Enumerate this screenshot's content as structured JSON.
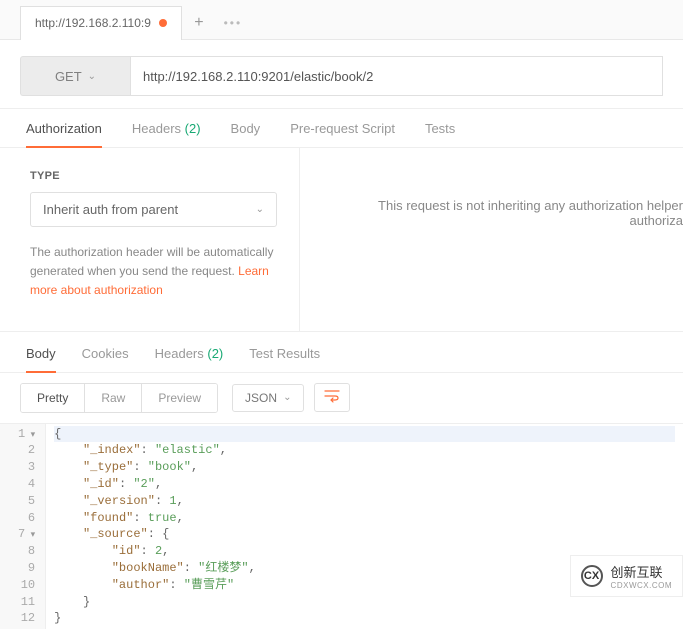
{
  "tabs": {
    "current": {
      "label": "http://192.168.2.110:9"
    }
  },
  "request": {
    "method": "GET",
    "url": "http://192.168.2.110:9201/elastic/book/2"
  },
  "req_tabs": {
    "authorization": "Authorization",
    "headers": "Headers",
    "headers_count": "(2)",
    "body": "Body",
    "prerequest": "Pre-request Script",
    "tests": "Tests"
  },
  "auth": {
    "type_label": "TYPE",
    "selected": "Inherit auth from parent",
    "help_prefix": "The authorization header will be automatically generated when you send the request. ",
    "help_link": "Learn more about authorization",
    "inherit_msg_line1": "This request is not inheriting any authorization helper",
    "inherit_msg_line2": "authoriza"
  },
  "resp_tabs": {
    "body": "Body",
    "cookies": "Cookies",
    "headers": "Headers",
    "headers_count": "(2)",
    "test_results": "Test Results"
  },
  "view": {
    "pretty": "Pretty",
    "raw": "Raw",
    "preview": "Preview",
    "format": "JSON"
  },
  "json": {
    "_index": "elastic",
    "_type": "book",
    "_id": "2",
    "_version": 1,
    "found": true,
    "_source": {
      "id": 2,
      "bookName": "红楼梦",
      "author": "曹雪芹"
    }
  },
  "logo": {
    "symbol": "CX",
    "text_top": "创新互联",
    "text_bottom": "CDXWCX.COM"
  }
}
